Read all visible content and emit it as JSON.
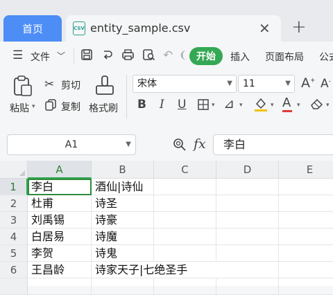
{
  "tabs": {
    "home_label": "首页",
    "file_label": "entity_sample.csv",
    "file_icon_text": "CSV"
  },
  "menu": {
    "file_label": "文件",
    "start_label": "开始",
    "insert_label": "插入",
    "layout_label": "页面布局",
    "formula_label": "公式"
  },
  "ribbon": {
    "paste_label": "粘贴",
    "cut_label": "剪切",
    "copy_label": "复制",
    "format_painter_label": "格式刷",
    "font_name": "宋体",
    "font_size": "11"
  },
  "formula_bar": {
    "cell_ref": "A1",
    "fx_label": "fx",
    "content": "李白"
  },
  "sheet": {
    "columns": [
      "A",
      "B",
      "C",
      "D",
      "E"
    ],
    "rows": [
      {
        "num": "1",
        "a": "李白",
        "b": "酒仙|诗仙"
      },
      {
        "num": "2",
        "a": "杜甫",
        "b": "诗圣"
      },
      {
        "num": "3",
        "a": "刘禹锡",
        "b": "诗豪"
      },
      {
        "num": "4",
        "a": "白居易",
        "b": "诗魔"
      },
      {
        "num": "5",
        "a": "李贺",
        "b": "诗鬼"
      },
      {
        "num": "6",
        "a": "王昌龄",
        "b": "诗家天子|七绝圣手"
      }
    ],
    "selected_cell": "A1"
  },
  "colors": {
    "accent_green": "#34a853",
    "home_tab_blue": "#4c8df6"
  }
}
